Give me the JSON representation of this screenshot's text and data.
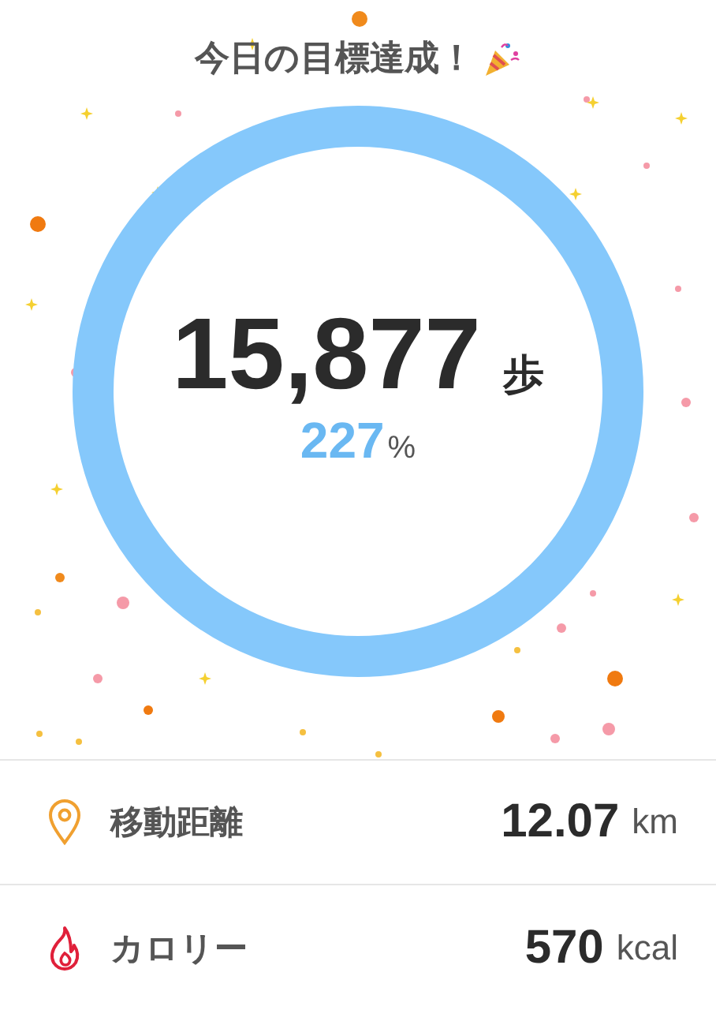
{
  "title": "今日の目標達成！",
  "steps": {
    "value": "15,877",
    "unit": "歩",
    "percent": "227",
    "percent_unit": "%"
  },
  "stats": [
    {
      "kind": "distance",
      "label": "移動距離",
      "value": "12.07",
      "unit": "km"
    },
    {
      "kind": "calories",
      "label": "カロリー",
      "value": "570",
      "unit": "kcal"
    }
  ]
}
